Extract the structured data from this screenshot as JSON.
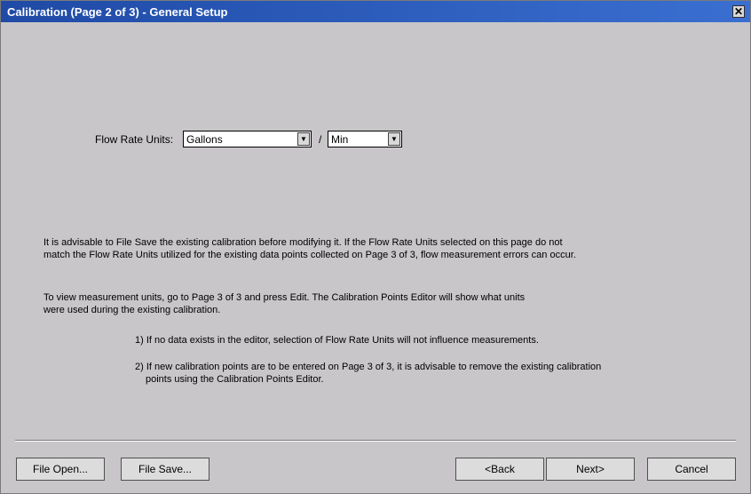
{
  "window": {
    "title": "Calibration (Page 2 of 3) - General Setup",
    "close_glyph": "✕"
  },
  "flow": {
    "label": "Flow Rate Units:",
    "volume_unit": "Gallons",
    "separator": "/",
    "time_unit": "Min",
    "arrow_glyph": "▼"
  },
  "info": {
    "para1_line1": "It is advisable to File Save the existing calibration before modifying it. If the Flow Rate Units selected on this page do not",
    "para1_line2": "match the Flow Rate Units utilized for the existing data points collected on Page 3 of 3, flow measurement errors can occur.",
    "para2_line1": "To view measurement units, go to Page 3 of 3 and press Edit. The Calibration Points Editor will show what units",
    "para2_line2": "were used during the existing calibration.",
    "point1": "1) If no data exists in the editor, selection of Flow Rate Units will not influence measurements.",
    "point2_line1": "2) If new calibration points are to be entered on Page 3 of 3, it is advisable to remove the existing calibration",
    "point2_line2": "points using the Calibration Points Editor."
  },
  "buttons": {
    "file_open": "File Open...",
    "file_save": "File Save...",
    "back": "<Back",
    "next": "Next>",
    "cancel": "Cancel"
  }
}
